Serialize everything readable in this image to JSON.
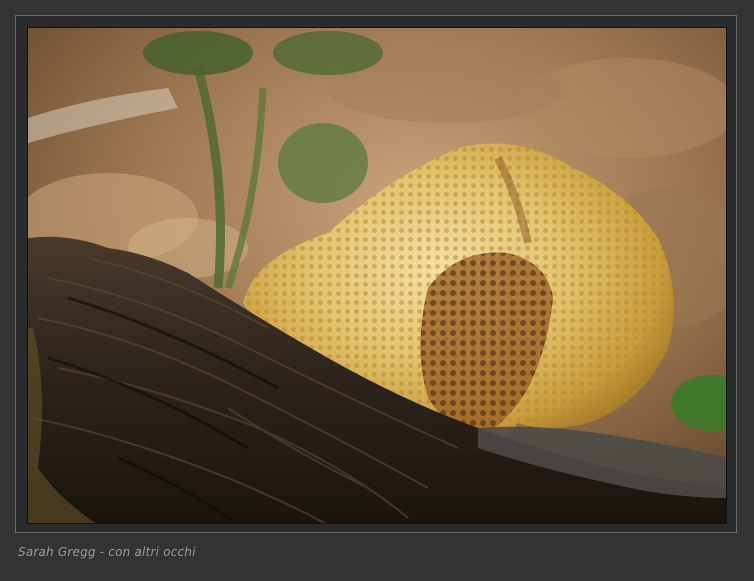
{
  "photo": {
    "subject": "mushroom-on-log"
  },
  "caption": {
    "text": "Sarah Gregg - con altri occhi"
  },
  "colors": {
    "background": "#333436",
    "frame": "#6a6b6e",
    "caption": "#9a9b9e"
  }
}
